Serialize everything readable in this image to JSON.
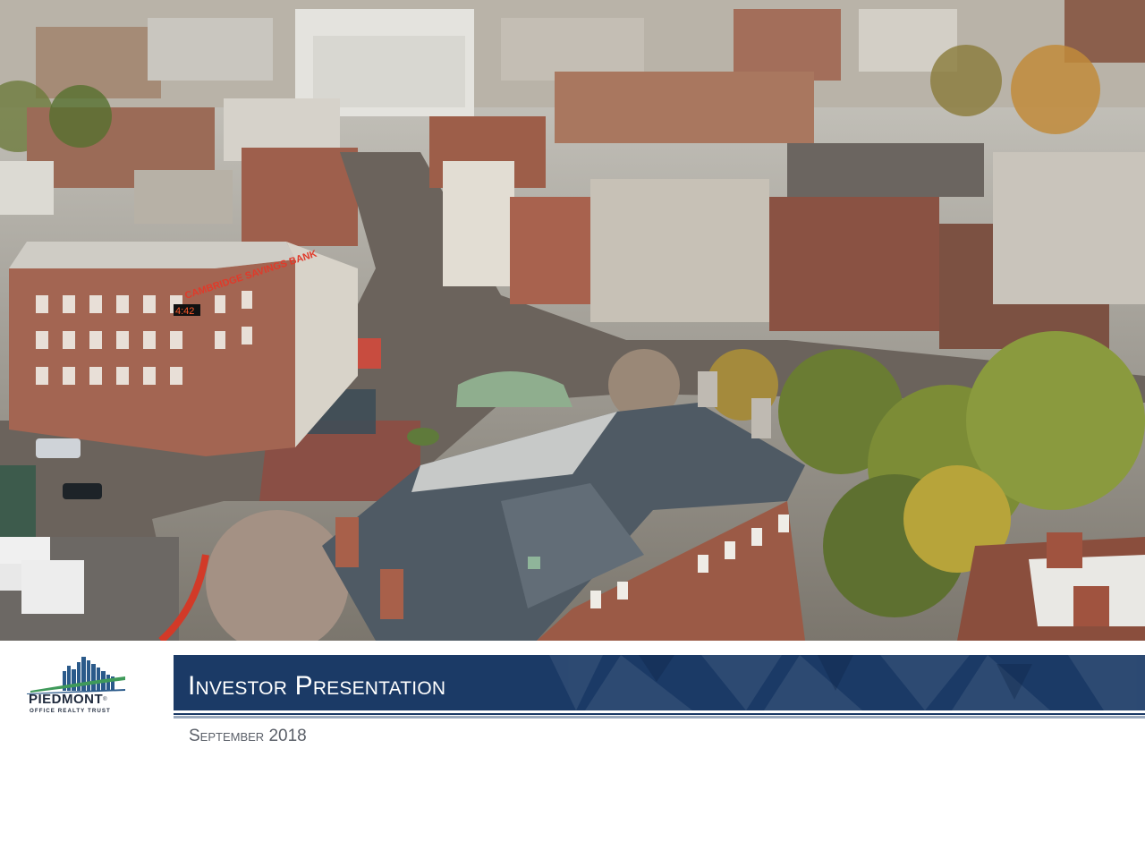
{
  "slide": {
    "title": "Investor Presentation",
    "date": "September 2018"
  },
  "logo": {
    "name": "PIEDMONT",
    "trademark": "®",
    "tagline": "OFFICE REALTY TRUST",
    "icon": "city-skyline-icon"
  },
  "photo": {
    "signage": "CAMBRIDGE SAVINGS BANK",
    "clock": "4:42"
  },
  "colors": {
    "navy": "#1b3a66",
    "light_rule": "#9aa9bd",
    "date_text": "#5a5f68",
    "logo_blue": "#2b5a8a",
    "logo_green": "#3f9a5a"
  }
}
